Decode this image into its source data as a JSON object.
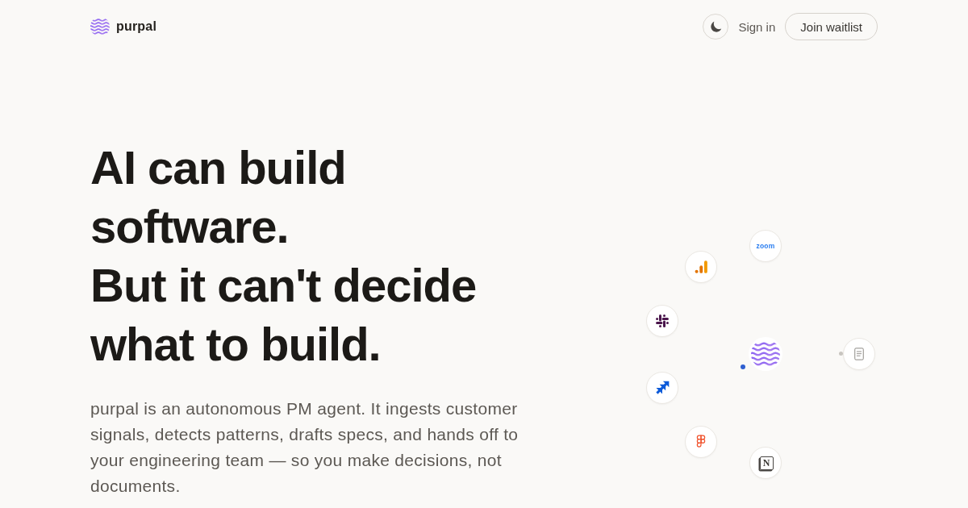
{
  "header": {
    "brand": "purpal",
    "sign_in": "Sign in",
    "cta": "Join waitlist"
  },
  "hero": {
    "headline": [
      "AI can build software.",
      "But it can't decide what to build."
    ],
    "description": "purpal is an autonomous PM agent. It ingests customer signals, detects patterns, drafts specs, and hands off to your engineering team — so you make decisions, not documents."
  },
  "integrations": [
    {
      "kind": "wordmark",
      "label": "zoom"
    },
    {
      "kind": "bars"
    },
    {
      "kind": "hash"
    },
    {
      "kind": "document"
    },
    {
      "kind": "chevrons"
    },
    {
      "kind": "shapes"
    },
    {
      "kind": "letter",
      "label": "N"
    }
  ]
}
